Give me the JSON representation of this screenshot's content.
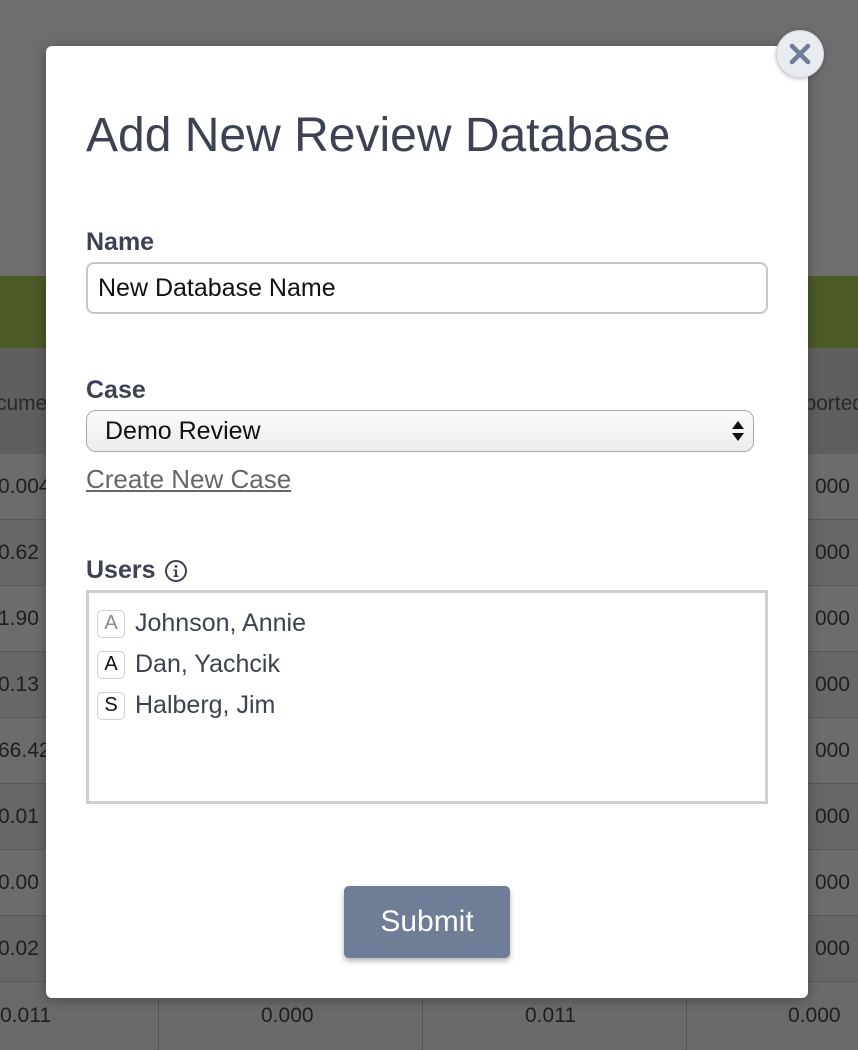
{
  "background": {
    "header_left": "cume",
    "header_right": "ported",
    "rows": [
      {
        "left": "0.004",
        "right": "000"
      },
      {
        "left": "0.62",
        "right": "000"
      },
      {
        "left": "1.90",
        "right": "000"
      },
      {
        "left": "0.13",
        "right": "000"
      },
      {
        "left": "66.42",
        "right": "000"
      },
      {
        "left": "0.01",
        "right": "000"
      },
      {
        "left": "0.00",
        "right": "000"
      },
      {
        "left": "0.02",
        "right": "000"
      }
    ],
    "last_row": [
      "0.011",
      "0.000",
      "0.011",
      "0.000"
    ]
  },
  "modal": {
    "title": "Add New Review Database",
    "close_icon": "close-x-icon",
    "name_label": "Name",
    "name_value": "New Database Name",
    "case_label": "Case",
    "case_selected": "Demo Review",
    "create_case_link": "Create New Case",
    "users_label": "Users",
    "users_info_icon": "info-icon",
    "users": [
      {
        "role": "A",
        "name": "Johnson, Annie"
      },
      {
        "role": "A",
        "name": "Dan, Yachcik"
      },
      {
        "role": "S",
        "name": "Halberg, Jim"
      }
    ],
    "submit_label": "Submit"
  },
  "colors": {
    "title_text": "#3c4253",
    "submit_bg": "#6f7d96",
    "overlay_green": "#4b5a26"
  }
}
